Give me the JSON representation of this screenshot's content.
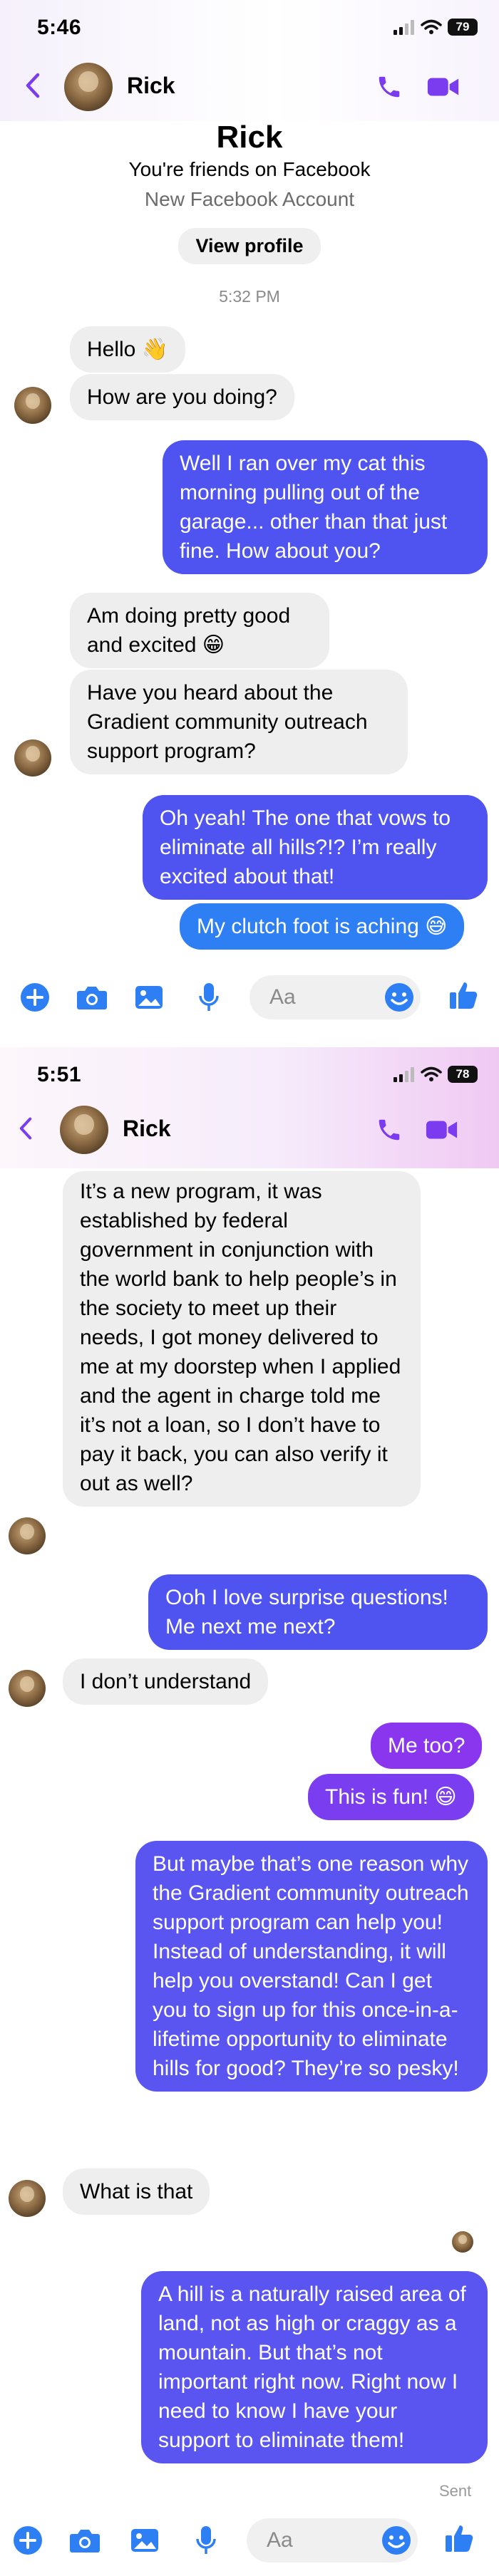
{
  "colors": {
    "accent": "#7b3cf0",
    "incoming_bubble": "#eeeeee",
    "outgoing_blue": "#4f54f0",
    "outgoing_purple": "#8a35ee"
  },
  "screen1": {
    "status": {
      "time": "5:46",
      "battery": "79"
    },
    "header": {
      "contact_name": "Rick",
      "icons": [
        "back-chevron-icon",
        "phone-icon",
        "video-camera-icon"
      ]
    },
    "intro": {
      "name": "Rick",
      "friends_text": "You're friends on Facebook",
      "account_text": "New Facebook Account",
      "view_profile_label": "View profile"
    },
    "timestamp": "5:32 PM",
    "messages": [
      {
        "from": "Rick",
        "text": "Hello 👋"
      },
      {
        "from": "Rick",
        "text": "How are you doing?"
      },
      {
        "from": "me",
        "text": "Well I ran over my cat this morning pulling out of the garage... other than that just fine. How about you?"
      },
      {
        "from": "Rick",
        "text": "Am doing pretty good and excited 😁"
      },
      {
        "from": "Rick",
        "text": "Have you heard about the Gradient community outreach support program?"
      },
      {
        "from": "me",
        "text": "Oh yeah! The one that vows to eliminate all hills?!? I’m really excited about that!"
      },
      {
        "from": "me",
        "text": "My clutch foot is aching 😅"
      }
    ],
    "composer": {
      "placeholder": "Aa",
      "icons": [
        "plus-icon",
        "camera-icon",
        "gallery-icon",
        "microphone-icon",
        "emoji-icon",
        "thumbs-up-icon"
      ]
    }
  },
  "screen2": {
    "status": {
      "time": "5:51",
      "battery": "78"
    },
    "header": {
      "contact_name": "Rick"
    },
    "messages": [
      {
        "from": "Rick",
        "text": "It’s a new program, it was established by federal government in conjunction with the world bank to help people’s in the society to meet up their needs, I got money delivered to me at my doorstep when I applied and the agent in charge told me it’s not a loan, so I don’t have to pay it back, you can also verify it out as well?"
      },
      {
        "from": "me",
        "text": "Ooh I love surprise questions! Me next me next?"
      },
      {
        "from": "Rick",
        "text": "I don’t understand"
      },
      {
        "from": "me",
        "text": "Me too?"
      },
      {
        "from": "me",
        "text": "This is fun! 😄"
      },
      {
        "from": "me",
        "text": "But maybe that’s one reason why the Gradient community outreach support program can help you! Instead of understanding, it will help you overstand! Can I get you to sign up for this once-in-a-lifetime opportunity to eliminate hills for good? They’re so pesky!"
      },
      {
        "from": "Rick",
        "text": "What is that"
      },
      {
        "from": "me",
        "text": "A hill is a naturally raised area of land, not as high or craggy as a mountain. But that’s not important right now. Right now I need to know I have your support to eliminate them!"
      }
    ],
    "sent_label": "Sent",
    "composer": {
      "placeholder": "Aa"
    }
  }
}
